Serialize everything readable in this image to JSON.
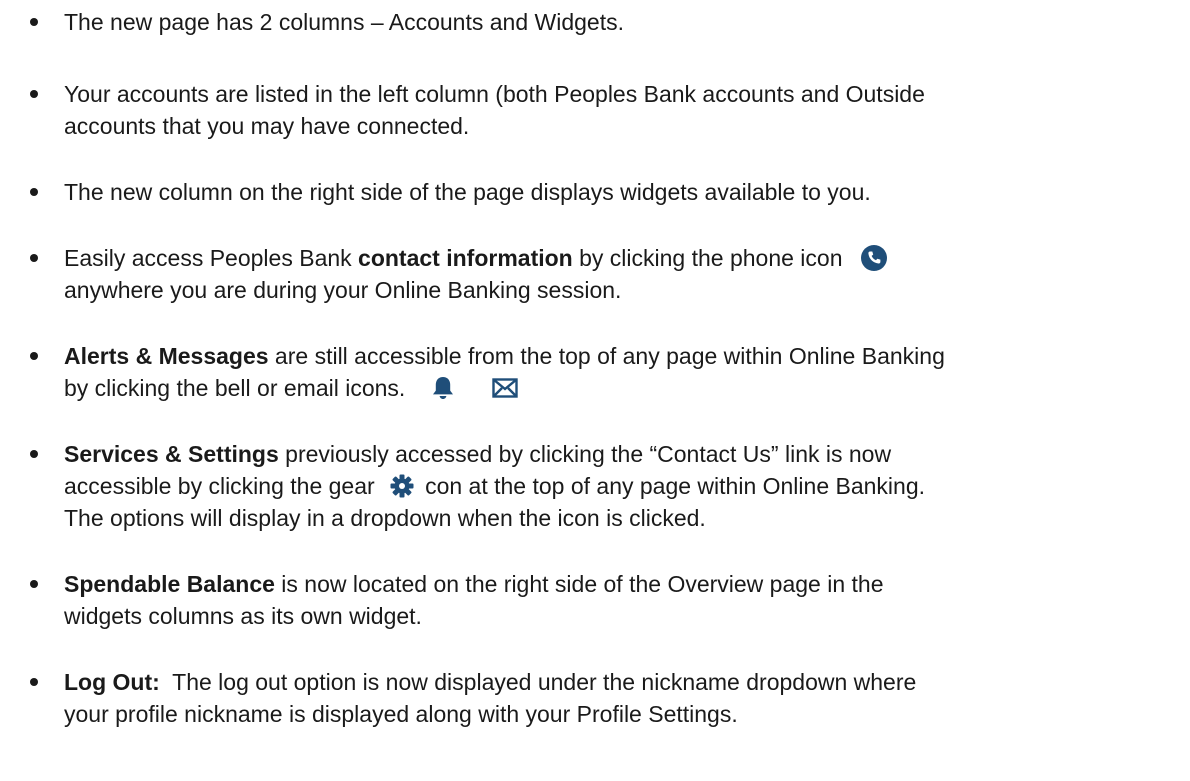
{
  "colors": {
    "text": "#1a1a1a",
    "icon": "#1f4e79"
  },
  "icons": [
    "phone-icon",
    "bell-icon",
    "envelope-icon",
    "gear-icon"
  ],
  "bullets": {
    "b1": {
      "text": "The new page has 2 columns – Accounts and Widgets."
    },
    "b2": {
      "line1": "Your accounts are listed in the left column (both Peoples Bank accounts and Outside",
      "line2": "accounts that you may have connected."
    },
    "b3": {
      "text": "The new column on the right side of the page displays widgets available to you."
    },
    "b4": {
      "pre": "Easily access Peoples Bank ",
      "bold": "contact information",
      "post": " by clicking the phone icon",
      "line2": "anywhere you are during your Online Banking session."
    },
    "b5": {
      "bold": "Alerts & Messages",
      "post": " are still accessible from the top of any page within Online Banking",
      "line2": "by clicking the bell or email icons."
    },
    "b6": {
      "bold": "Services & Settings",
      "post": " previously accessed by clicking the “Contact Us” link is now",
      "line2_pre": "accessible by clicking the gear",
      "line2_post": "con  at the top of any page within Online Banking.",
      "line3": "The options will display in a dropdown when the icon is clicked."
    },
    "b7": {
      "bold": "Spendable Balance",
      "post": " is now located on the right side of the Overview page in the",
      "line2": "widgets columns as its own widget."
    },
    "b8": {
      "bold": "Log Out:",
      "post": "  The log out option is now displayed under the nickname dropdown where",
      "line2": "your profile nickname is displayed along with your Profile Settings."
    }
  }
}
